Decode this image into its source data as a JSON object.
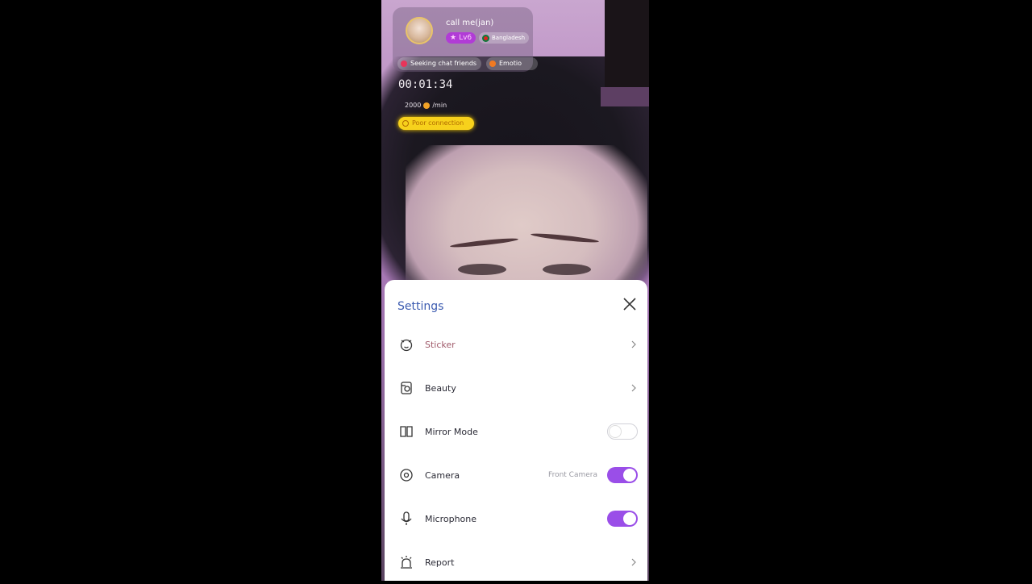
{
  "profile": {
    "username": "call me(jan)",
    "level": "Lv6",
    "country": "Bangladesh",
    "tags": [
      {
        "label": "Seeking chat friends",
        "color": "#e8345a"
      },
      {
        "label": "Emotio",
        "color": "#f07a22"
      }
    ]
  },
  "call": {
    "timer": "00:01:34",
    "rate": "2000",
    "rate_unit": "/min",
    "connection_status": "Poor connection"
  },
  "settings": {
    "title": "Settings",
    "items": [
      {
        "label": "Sticker",
        "icon": "sticker-icon",
        "control": "chevron"
      },
      {
        "label": "Beauty",
        "icon": "beauty-icon",
        "control": "chevron"
      },
      {
        "label": "Mirror Mode",
        "icon": "mirror-icon",
        "control": "toggle",
        "value": false
      },
      {
        "label": "Camera",
        "icon": "camera-icon",
        "control": "toggle",
        "value": true,
        "extra": "Front Camera"
      },
      {
        "label": "Microphone",
        "icon": "microphone-icon",
        "control": "toggle",
        "value": true
      },
      {
        "label": "Report",
        "icon": "alarm-icon",
        "control": "chevron"
      }
    ]
  },
  "colors": {
    "accent": "#9a4ee8",
    "title": "#3c5bb0",
    "level_badge": "#b13cd6",
    "warning": "#f7d11c"
  }
}
